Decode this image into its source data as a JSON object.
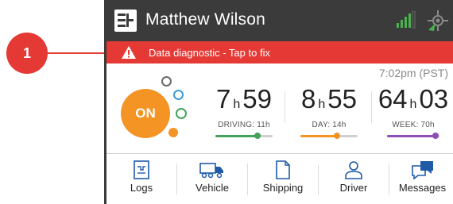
{
  "callout": {
    "number": "1"
  },
  "header": {
    "user_name": "Matthew Wilson"
  },
  "alert": {
    "text": "Data diagnostic - Tap to fix"
  },
  "status": {
    "time": "7:02pm (PST)",
    "duty_status": "ON"
  },
  "counters": [
    {
      "hours": "7",
      "unit": "h",
      "minutes": "59",
      "label": "DRIVING: 11h",
      "progress": 0.73,
      "color": "#43a35b"
    },
    {
      "hours": "8",
      "unit": "h",
      "minutes": "55",
      "label": "DAY: 14h",
      "progress": 0.64,
      "color": "#f39425"
    },
    {
      "hours": "64",
      "unit": "h",
      "minutes": "03",
      "label": "WEEK: 70h",
      "progress": 0.92,
      "color": "#8e4fb5"
    }
  ],
  "nav": [
    {
      "label": "Logs",
      "icon": "logs-icon"
    },
    {
      "label": "Vehicle",
      "icon": "truck-icon"
    },
    {
      "label": "Shipping",
      "icon": "document-icon"
    },
    {
      "label": "Driver",
      "icon": "person-icon"
    },
    {
      "label": "Messages",
      "icon": "messages-icon"
    }
  ],
  "colors": {
    "topbar": "#3b3b3b",
    "alert": "#e53935",
    "on_status": "#f39425",
    "nav_icon": "#1e5aa8",
    "signal": "#4caf50"
  }
}
